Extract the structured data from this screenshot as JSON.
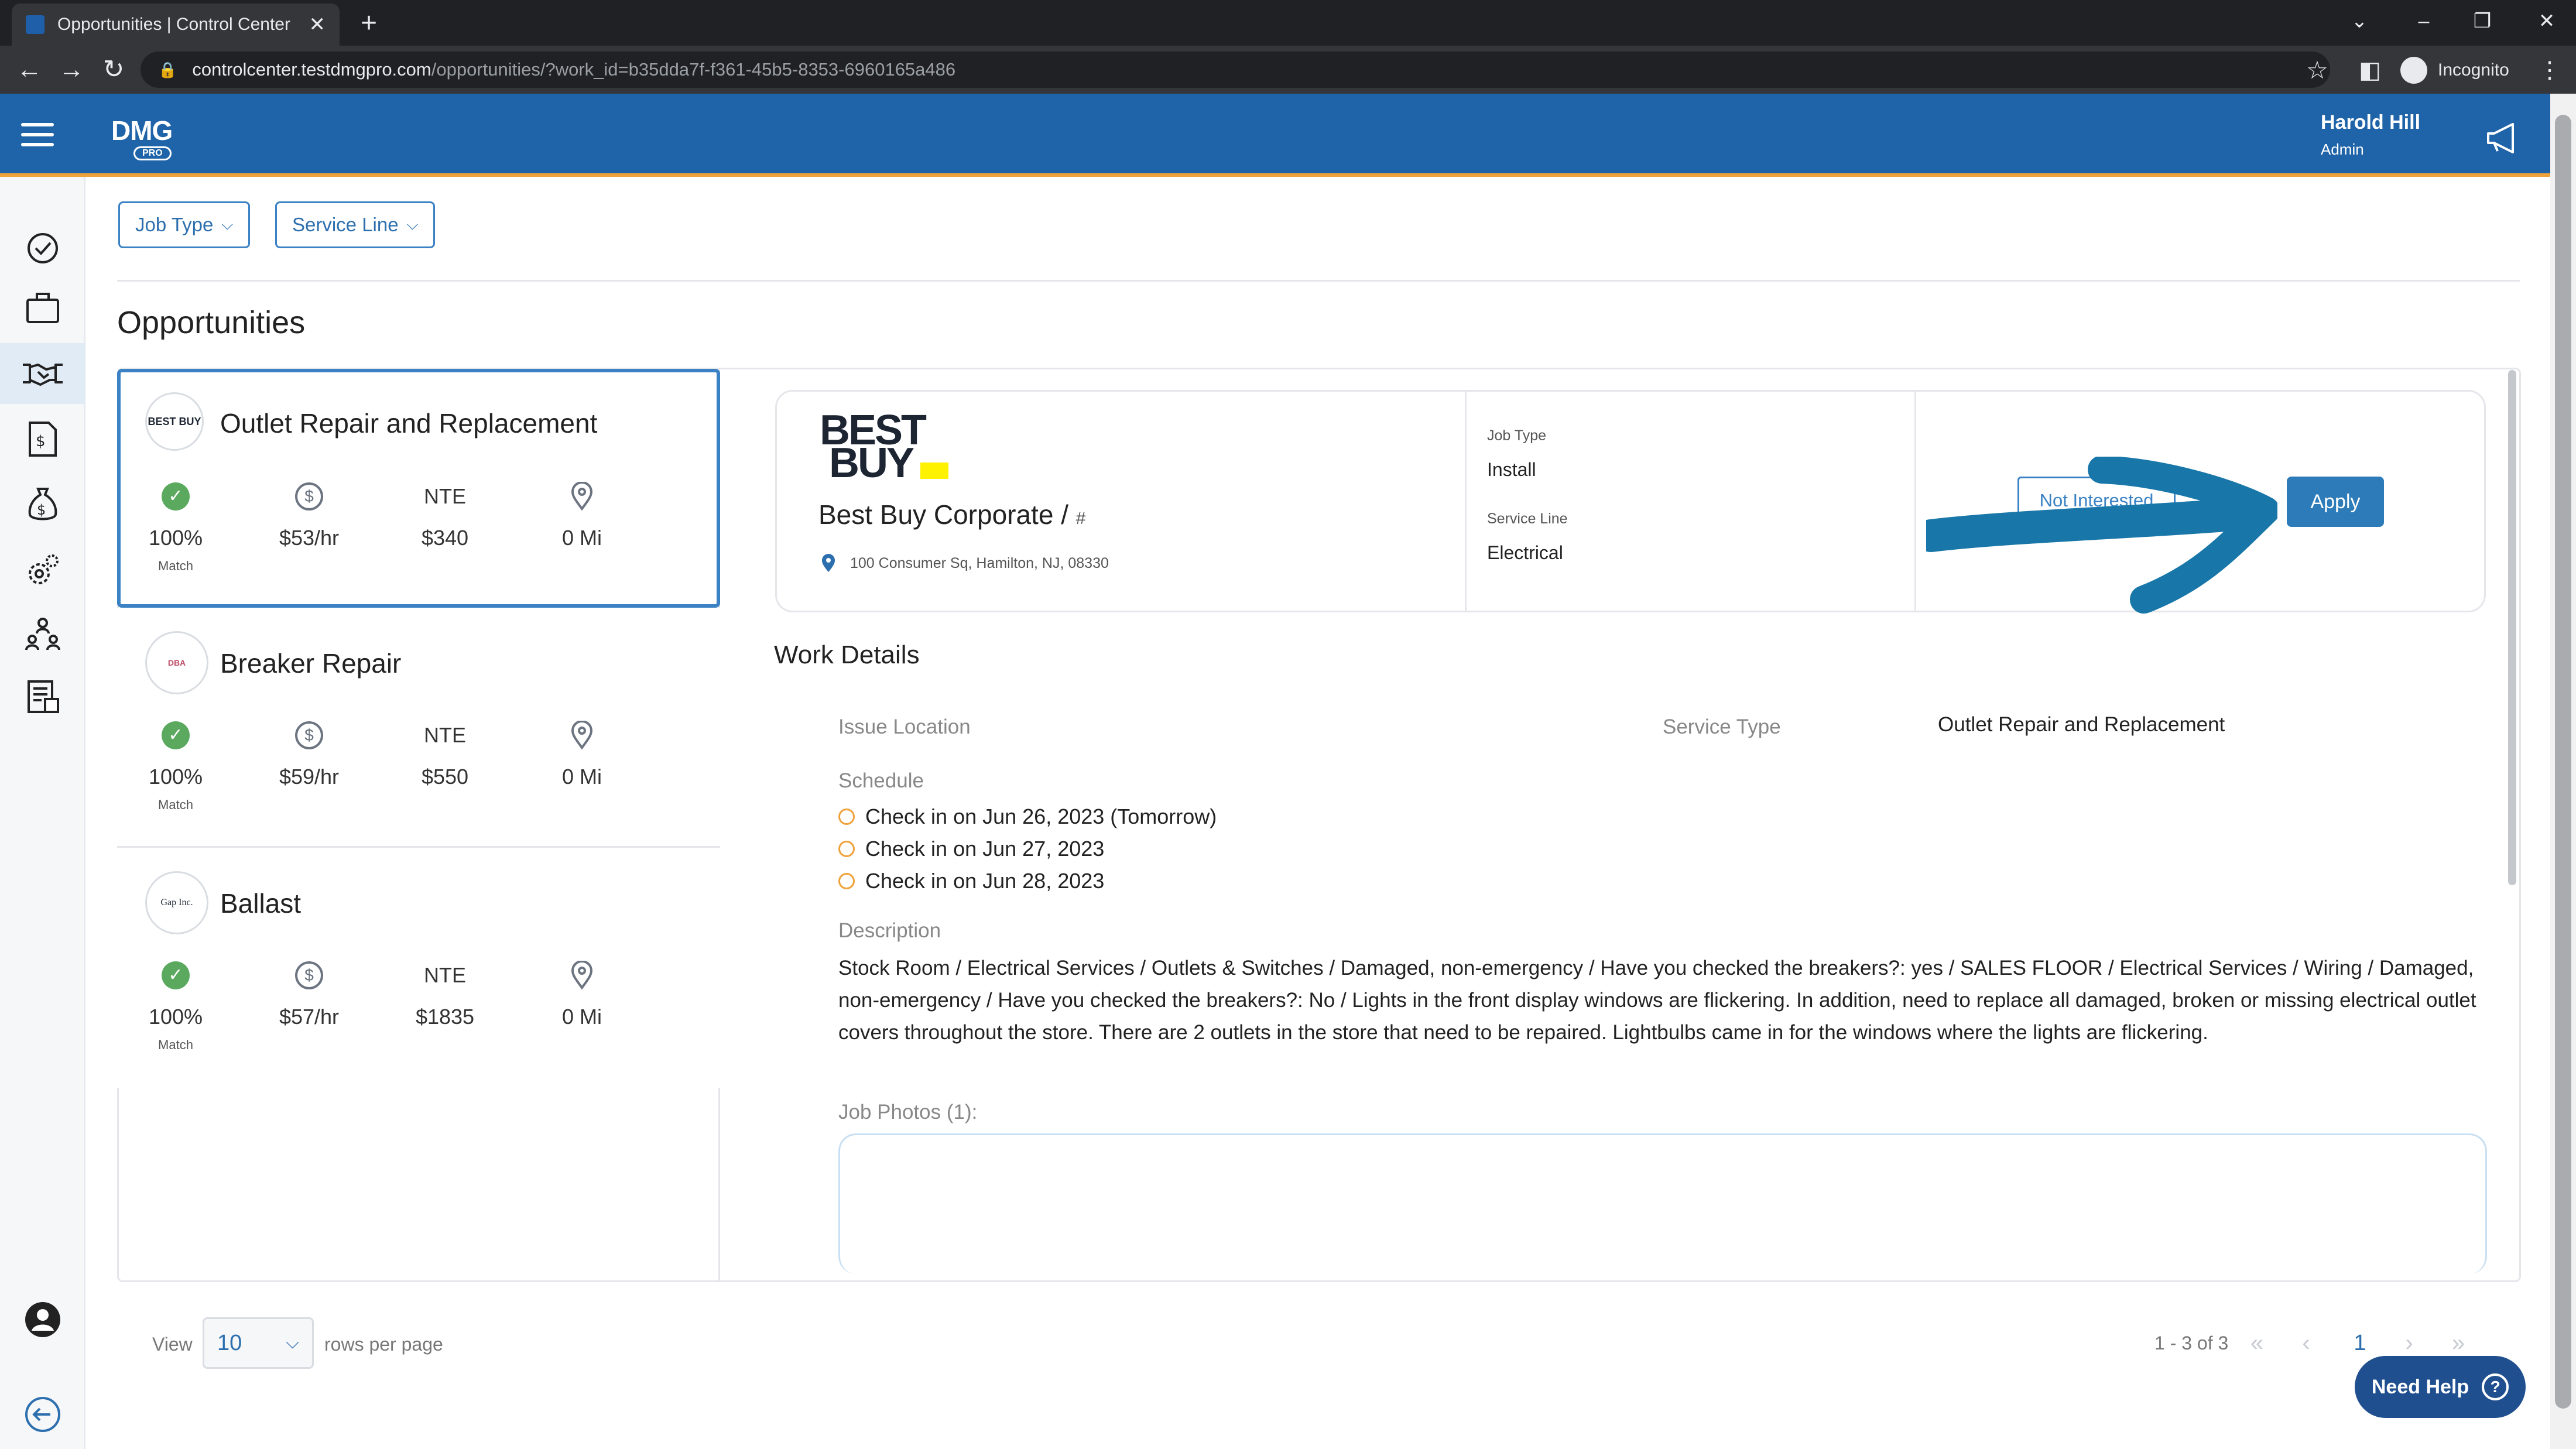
{
  "browser": {
    "tab_title": "Opportunities | Control Center",
    "url_host": "controlcenter.testdmgpro.com",
    "url_path": "/opportunities/?work_id=b35dda7f-f361-45b5-8353-6960165a486",
    "profile_label": "Incognito"
  },
  "header": {
    "logo_text": "DMG",
    "logo_sub": "PRO",
    "user_name": "Harold Hill",
    "user_role": "Admin"
  },
  "filters": {
    "job_type": "Job Type",
    "service_line": "Service Line"
  },
  "page_title": "Opportunities",
  "opportunities": [
    {
      "title": "Outlet Repair and Replacement",
      "logo_text": "BEST BUY",
      "match": "100%",
      "match_label": "Match",
      "rate": "$53/hr",
      "nte_label": "NTE",
      "nte": "$340",
      "distance": "0 Mi"
    },
    {
      "title": "Breaker Repair",
      "logo_text": "DBA",
      "match": "100%",
      "match_label": "Match",
      "rate": "$59/hr",
      "nte_label": "NTE",
      "nte": "$550",
      "distance": "0 Mi"
    },
    {
      "title": "Ballast",
      "logo_text": "Gap Inc.",
      "match": "100%",
      "match_label": "Match",
      "rate": "$57/hr",
      "nte_label": "NTE",
      "nte": "$1835",
      "distance": "0 Mi"
    }
  ],
  "detail": {
    "logo_line1": "BEST",
    "logo_line2": "BUY",
    "company": "Best Buy Corporate /",
    "company_suffix": "#",
    "address": "100 Consumer Sq, Hamilton, NJ, 08330",
    "job_type_label": "Job Type",
    "job_type": "Install",
    "service_line_label": "Service Line",
    "service_line": "Electrical",
    "not_interested": "Not Interested",
    "apply": "Apply"
  },
  "work_details": {
    "title": "Work Details",
    "issue_location_label": "Issue Location",
    "service_type_label": "Service Type",
    "service_type": "Outlet Repair and Replacement",
    "schedule_label": "Schedule",
    "schedule": [
      "Check in on Jun 26, 2023 (Tomorrow)",
      "Check in on Jun 27, 2023",
      "Check in on Jun 28, 2023"
    ],
    "description_label": "Description",
    "description": "Stock Room / Electrical Services / Outlets & Switches / Damaged, non-emergency / Have you checked the breakers?: yes / SALES FLOOR / Electrical Services / Wiring / Damaged, non-emergency / Have you checked the breakers?: No / Lights in the front display windows are flickering. In addition, need to replace all damaged, broken or missing electrical outlet covers throughout the store. There are 2 outlets in the store that need to be repaired. Lightbulbs came in for the windows where the lights are flickering.",
    "photos_label": "Job Photos (1):"
  },
  "pagination": {
    "view_label": "View",
    "rows_value": "10",
    "rows_label": "rows per page",
    "range": "1 - 3 of 3",
    "current_page": "1"
  },
  "help": {
    "label": "Need Help"
  },
  "colors": {
    "header_blue": "#1f64a8",
    "header_accent": "#f0a23a",
    "primary": "#2d7bb8",
    "match_green": "#5ba85f"
  }
}
